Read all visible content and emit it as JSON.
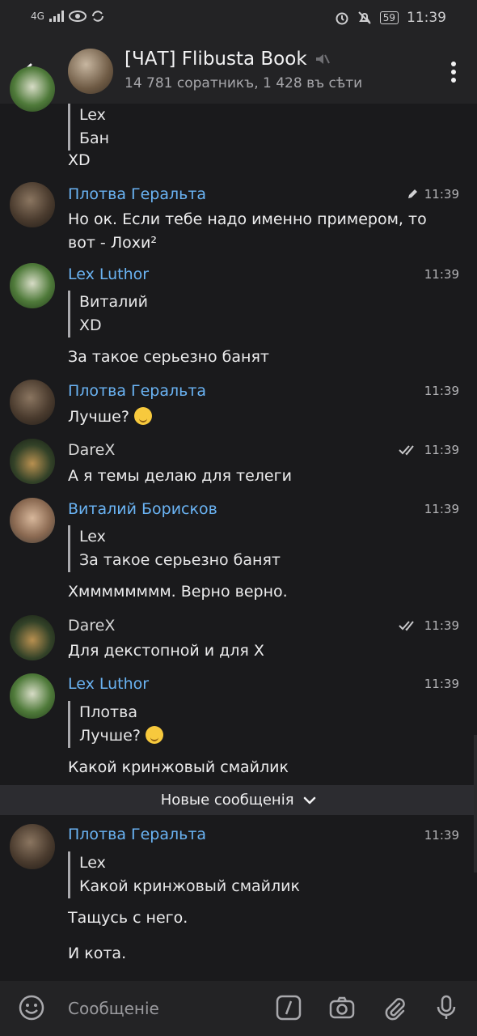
{
  "statusbar": {
    "left": "4G",
    "battery": "59",
    "time": "11:39"
  },
  "header": {
    "title": "[ЧАТ] Flibusta Book",
    "subtitle": "14 781 соратникъ, 1 428 въ сѣти"
  },
  "messages": {
    "m0": {
      "reply_name": "Lex",
      "reply_text": "Бан",
      "text": "XD"
    },
    "m1": {
      "sender": "Плотва Геральта",
      "time": "11:39",
      "text": "Но ок. Если тебе надо именно примером, то вот - Лохи²"
    },
    "m2": {
      "sender": "Lex Luthor",
      "time": "11:39",
      "reply_name": "Виталий",
      "reply_text": "XD",
      "text": "За такое серьезно банят"
    },
    "m3": {
      "sender": "Плотва Геральта",
      "time": "11:39",
      "text": "Лучше?"
    },
    "m4": {
      "sender": "DareX",
      "time": "11:39",
      "text": "А я темы делаю для телеги"
    },
    "m5": {
      "sender": "Виталий Борисков",
      "time": "11:39",
      "reply_name": "Lex",
      "reply_text": "За такое серьезно банят",
      "text": "Хмммммммм. Верно верно."
    },
    "m6": {
      "sender": "DareX",
      "time": "11:39",
      "text": "Для декстопной и для Х"
    },
    "m7": {
      "sender": "Lex Luthor",
      "time": "11:39",
      "reply_name": "Плотва",
      "reply_text": "Лучше?",
      "text": "Какой кринжовый смайлик"
    },
    "m8": {
      "sender": "Плотва Геральта",
      "time": "11:39",
      "reply_name": "Lex",
      "reply_text": "Какой кринжовый смайлик",
      "text1": "Тащусь с него.",
      "text2": "И кота."
    }
  },
  "divider": {
    "label": "Новые сообщенія"
  },
  "composer": {
    "placeholder": "Сообщеніе"
  }
}
